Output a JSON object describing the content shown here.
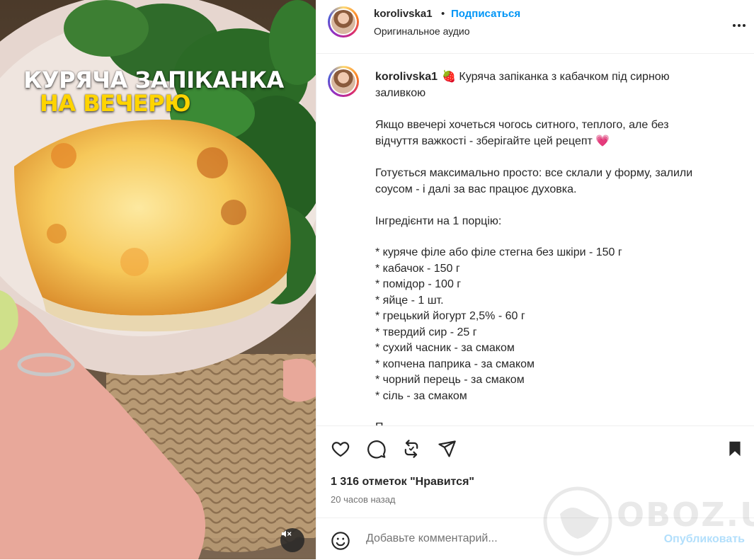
{
  "media": {
    "overlay_line1": "КУРЯЧА ЗАПІКАНКА",
    "overlay_line2": "НА ВЕЧЕРЮ",
    "mute_icon": "speaker-muted-icon"
  },
  "header": {
    "username": "korolivska1",
    "separator": "•",
    "follow_label": "Подписаться",
    "audio_label": "Оригинальное аудио",
    "more_icon": "more-dots-icon"
  },
  "caption": {
    "username": "korolivska1",
    "title": "🍓 Куряча запіканка з кабачком під сирною заливкою",
    "lines": [
      "Якщо ввечері хочеться чогось ситного, теплого, але без",
      "відчуття важкості - зберігайте цей рецепт 💗",
      "Готується максимально просто: все склали у форму, залили",
      "соусом - і далі за вас працює духовка.",
      "Інгредієнти на 1 порцію:",
      "* куряче філе або філе стегна без шкіри - 150 г",
      "* кабачок - 150 г",
      "* помідор - 100 г",
      "* яйце - 1 шт.",
      "* грецький йогурт 2,5% - 60 г",
      "* твердий сир - 25 г",
      "* сухий часник - за смаком",
      "* копчена паприка - за смаком",
      "* чорний перець - за смаком",
      "* сіль - за смаком",
      "П"
    ]
  },
  "actions": {
    "like_icon": "heart-icon",
    "comment_icon": "comment-icon",
    "repost_icon": "repost-icon",
    "share_icon": "send-icon",
    "save_icon": "bookmark-icon"
  },
  "stats": {
    "likes": "1 316 отметок \"Нравится\"",
    "time": "20 часов назад"
  },
  "comment": {
    "placeholder": "Добавьте комментарий...",
    "post_label": "Опубликовать",
    "emoji_icon": "smiley-icon"
  },
  "watermark": {
    "text": "OBOZ.UA"
  },
  "colors": {
    "accent_blue": "#0095f6",
    "post_disabled": "#b2dffc",
    "overlay_yellow": "#ffd400"
  }
}
